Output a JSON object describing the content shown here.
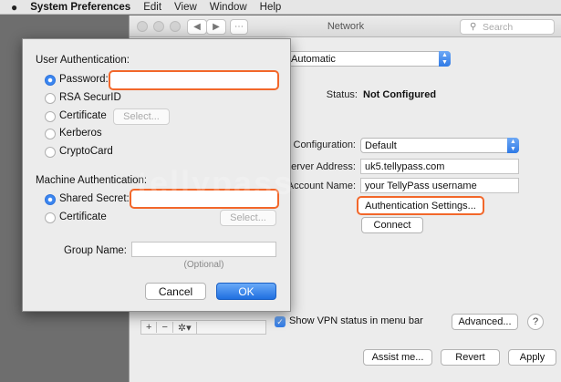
{
  "menubar": {
    "app_name": "System Preferences",
    "items": [
      "Edit",
      "View",
      "Window",
      "Help"
    ]
  },
  "window": {
    "title": "Network",
    "search_placeholder": "Search",
    "location_value": "Automatic",
    "status_label": "Status:",
    "status_value": "Not Configured",
    "configuration_label": "Configuration:",
    "configuration_value": "Default",
    "server_label": "Server Address:",
    "server_value": "uk5.tellypass.com",
    "account_label": "Account Name:",
    "account_value": "your TellyPass username",
    "auth_settings_label": "Authentication Settings...",
    "connect_label": "Connect",
    "show_vpn_label": "Show VPN status in menu bar",
    "advanced_label": "Advanced...",
    "help_label": "?",
    "assist_label": "Assist me...",
    "revert_label": "Revert",
    "apply_label": "Apply",
    "sidebar_tools": [
      "+",
      "−",
      "✲▾"
    ]
  },
  "sheet": {
    "user_auth_heading": "User Authentication:",
    "user_options": [
      {
        "label": "Password:",
        "selected": true
      },
      {
        "label": "RSA SecurID",
        "selected": false
      },
      {
        "label": "Certificate",
        "selected": false
      },
      {
        "label": "Kerberos",
        "selected": false
      },
      {
        "label": "CryptoCard",
        "selected": false
      }
    ],
    "select_label": "Select...",
    "machine_auth_heading": "Machine Authentication:",
    "machine_options": [
      {
        "label": "Shared Secret:",
        "selected": true
      },
      {
        "label": "Certificate",
        "selected": false
      }
    ],
    "group_name_label": "Group Name:",
    "optional_label": "(Optional)",
    "cancel_label": "Cancel",
    "ok_label": "OK"
  },
  "watermark": "tellypass",
  "colors": {
    "highlight": "#f2672a",
    "accent": "#2f7ae6"
  }
}
